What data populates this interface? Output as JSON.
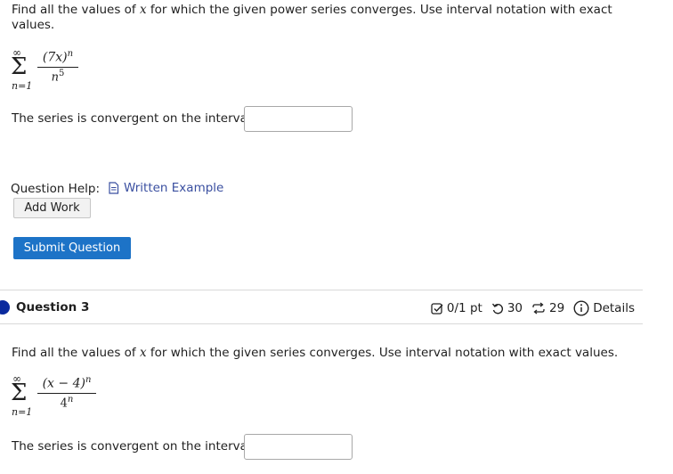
{
  "q2": {
    "prompt_before": "Find all the values of ",
    "prompt_var": "x",
    "prompt_after": " for which the given power series converges. Use interval notation with exact values.",
    "sum_upper": "∞",
    "sum_lower": "n=1",
    "numerator": "(7x)",
    "numerator_power": "n",
    "denominator": "n",
    "denominator_power": "5",
    "answer_label": "The series is convergent on the interval",
    "answer_value": "",
    "help_label": "Question Help:",
    "written_example": "Written Example",
    "add_work": "Add Work",
    "submit": "Submit Question"
  },
  "q3": {
    "title": "Question 3",
    "score": "0/1 pt",
    "retries": "30",
    "attempts": "29",
    "details": "Details",
    "prompt_before": "Find all the values of ",
    "prompt_var": "x",
    "prompt_after": " for which the given series converges. Use interval notation with exact values.",
    "sum_upper": "∞",
    "sum_lower": "n=1",
    "numerator": "(x − 4)",
    "numerator_power": "n",
    "denominator": "4",
    "denominator_power": "n",
    "answer_label": "The series is convergent on the interval",
    "answer_value": ""
  },
  "colors": {
    "submit_bg": "#1d73c7",
    "question_dot": "#0b2a9e",
    "link": "#3a4fa0"
  }
}
